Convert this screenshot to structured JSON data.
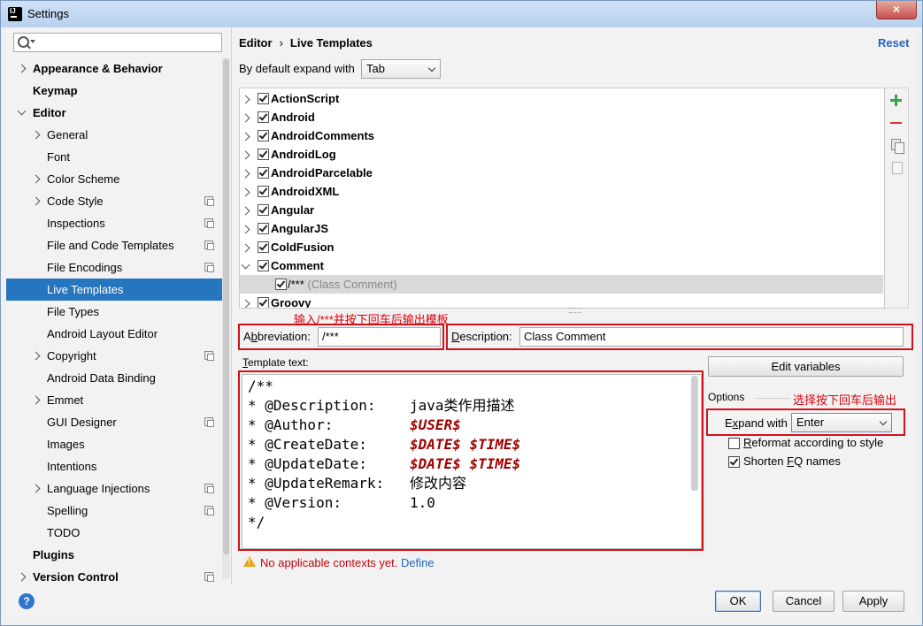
{
  "window": {
    "title": "Settings",
    "close_glyph": "×"
  },
  "search": {
    "placeholder": ""
  },
  "sidebar": {
    "items": [
      {
        "label": "Appearance & Behavior",
        "bold": true,
        "chevron": "right",
        "indent": 0
      },
      {
        "label": "Keymap",
        "bold": true,
        "chevron": "none",
        "indent": 0
      },
      {
        "label": "Editor",
        "bold": true,
        "chevron": "down",
        "indent": 0
      },
      {
        "label": "General",
        "bold": false,
        "chevron": "right",
        "indent": 1
      },
      {
        "label": "Font",
        "bold": false,
        "chevron": "none",
        "indent": 1
      },
      {
        "label": "Color Scheme",
        "bold": false,
        "chevron": "right",
        "indent": 1
      },
      {
        "label": "Code Style",
        "bold": false,
        "chevron": "right",
        "indent": 1,
        "project_icon": true
      },
      {
        "label": "Inspections",
        "bold": false,
        "chevron": "none",
        "indent": 1,
        "project_icon": true
      },
      {
        "label": "File and Code Templates",
        "bold": false,
        "chevron": "none",
        "indent": 1,
        "project_icon": true
      },
      {
        "label": "File Encodings",
        "bold": false,
        "chevron": "none",
        "indent": 1,
        "project_icon": true
      },
      {
        "label": "Live Templates",
        "bold": false,
        "chevron": "none",
        "indent": 1,
        "selected": true
      },
      {
        "label": "File Types",
        "bold": false,
        "chevron": "none",
        "indent": 1
      },
      {
        "label": "Android Layout Editor",
        "bold": false,
        "chevron": "none",
        "indent": 1
      },
      {
        "label": "Copyright",
        "bold": false,
        "chevron": "right",
        "indent": 1,
        "project_icon": true
      },
      {
        "label": "Android Data Binding",
        "bold": false,
        "chevron": "none",
        "indent": 1
      },
      {
        "label": "Emmet",
        "bold": false,
        "chevron": "right",
        "indent": 1
      },
      {
        "label": "GUI Designer",
        "bold": false,
        "chevron": "none",
        "indent": 1,
        "project_icon": true
      },
      {
        "label": "Images",
        "bold": false,
        "chevron": "none",
        "indent": 1
      },
      {
        "label": "Intentions",
        "bold": false,
        "chevron": "none",
        "indent": 1
      },
      {
        "label": "Language Injections",
        "bold": false,
        "chevron": "right",
        "indent": 1,
        "project_icon": true
      },
      {
        "label": "Spelling",
        "bold": false,
        "chevron": "none",
        "indent": 1,
        "project_icon": true
      },
      {
        "label": "TODO",
        "bold": false,
        "chevron": "none",
        "indent": 1
      },
      {
        "label": "Plugins",
        "bold": true,
        "chevron": "none",
        "indent": 0
      },
      {
        "label": "Version Control",
        "bold": true,
        "chevron": "right",
        "indent": 0,
        "project_icon": true
      }
    ]
  },
  "breadcrumb": {
    "parent": "Editor",
    "separator": "›",
    "current": "Live Templates"
  },
  "reset_label": "Reset",
  "expand_default": {
    "label": "By default expand with",
    "value": "Tab"
  },
  "templates": {
    "groups": [
      {
        "name": "ActionScript",
        "checked": true,
        "expanded": false
      },
      {
        "name": "Android",
        "checked": true,
        "expanded": false
      },
      {
        "name": "AndroidComments",
        "checked": true,
        "expanded": false
      },
      {
        "name": "AndroidLog",
        "checked": true,
        "expanded": false
      },
      {
        "name": "AndroidParcelable",
        "checked": true,
        "expanded": false
      },
      {
        "name": "AndroidXML",
        "checked": true,
        "expanded": false
      },
      {
        "name": "Angular",
        "checked": true,
        "expanded": false
      },
      {
        "name": "AngularJS",
        "checked": true,
        "expanded": false
      },
      {
        "name": "ColdFusion",
        "checked": true,
        "expanded": false
      },
      {
        "name": "Comment",
        "checked": true,
        "expanded": true,
        "children": [
          {
            "abbr": "/***",
            "desc": "(Class Comment)",
            "checked": true
          }
        ]
      },
      {
        "name": "Groovy",
        "checked": true,
        "expanded": false
      }
    ]
  },
  "annotations": {
    "top": "输入/***并按下回车后输出模板",
    "right": "选择按下回车后输出"
  },
  "abbreviation": {
    "label_pre": "A",
    "label_mn": "b",
    "label_post": "breviation:",
    "value": "/***"
  },
  "description": {
    "label_pre": "",
    "label_mn": "D",
    "label_post": "escription:",
    "value": "Class Comment"
  },
  "template_text": {
    "label_pre": "",
    "label_mn": "T",
    "label_post": "emplate text:",
    "lines": [
      [
        {
          "t": "/**"
        }
      ],
      [
        {
          "t": "* @Description:    java类作用描述"
        }
      ],
      [
        {
          "t": "* @Author:         "
        },
        {
          "t": "$USER$",
          "var": true
        }
      ],
      [
        {
          "t": "* @CreateDate:     "
        },
        {
          "t": "$DATE$ $TIME$",
          "var": true
        }
      ],
      [
        {
          "t": "* @UpdateDate:     "
        },
        {
          "t": "$DATE$ $TIME$",
          "var": true
        }
      ],
      [
        {
          "t": "* @UpdateRemark:   修改内容"
        }
      ],
      [
        {
          "t": "* @Version:        1.0"
        }
      ],
      [
        {
          "t": "*/"
        }
      ]
    ]
  },
  "edit_variables_label": "Edit variables",
  "options": {
    "label": "Options",
    "expand_with": {
      "label_pre": "E",
      "label_mn": "x",
      "label_post": "pand with",
      "value": "Enter"
    },
    "reformat": {
      "label_pre": "",
      "label_mn": "R",
      "label_post": "eformat according to style",
      "checked": false
    },
    "shorten": {
      "label_pre": "Shorten ",
      "label_mn": "F",
      "label_post": "Q names",
      "checked": true
    }
  },
  "warning": {
    "text": "No applicable contexts yet.",
    "link": "Define"
  },
  "buttons": {
    "ok": "OK",
    "cancel": "Cancel",
    "apply": "Apply"
  },
  "help_glyph": "?",
  "colors": {
    "selection": "#2675bf",
    "annotation_red": "#e0000a",
    "link_blue": "#1e64c8",
    "template_variable": "#a30000"
  }
}
